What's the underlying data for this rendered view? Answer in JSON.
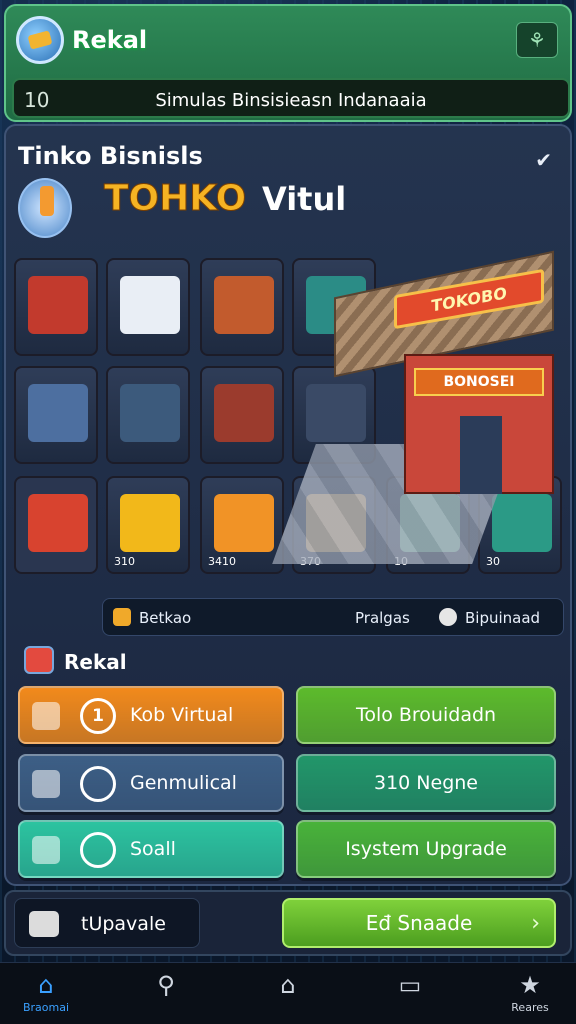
{
  "header": {
    "app_title": "Rekal",
    "level": "10",
    "subtitle": "Simulas Binsisieasn Indanaaia",
    "logo_icon": "coin-icon",
    "action_icon": "share-icon"
  },
  "panel": {
    "title": "Tinko Bisnisls",
    "collapse_icon": "chevron-down-icon",
    "brand_word1": "TOHKO",
    "brand_word2": "Vitul",
    "tiles": [
      {
        "name": "register",
        "label": "",
        "color": "#c23a2d"
      },
      {
        "name": "cart",
        "label": "",
        "color": "#e9eef5"
      },
      {
        "name": "shelf",
        "label": "",
        "color": "#c25b2d"
      },
      {
        "name": "cart-red",
        "label": "",
        "color": "#2b8c86"
      },
      {
        "name": "fridge",
        "label": "",
        "color": "#4d6fa0"
      },
      {
        "name": "blender",
        "label": "",
        "color": "#3c5a7c"
      },
      {
        "name": "display",
        "label": "",
        "color": "#9b3b2d"
      },
      {
        "name": "stall",
        "label": "",
        "color": "#3a4a66"
      },
      {
        "name": "bag",
        "label": "310",
        "color": "#f2b81a"
      },
      {
        "name": "tablet",
        "label": "3410",
        "color": "#f19326"
      },
      {
        "name": "counter",
        "label": "370",
        "color": "#e6b46b"
      },
      {
        "name": "cart-green",
        "label": "10",
        "color": "#7cc7a4"
      },
      {
        "name": "forklift",
        "label": "30",
        "color": "#2b9a86"
      }
    ],
    "store": {
      "sign_top": "TOKOBO",
      "sign_front": "BONOSEI"
    },
    "info": {
      "left_label": "Betkao",
      "mid_label": "Pralgas",
      "right_label": "Bipuinaad"
    }
  },
  "rekal": {
    "title": "Rekal",
    "buttons": [
      {
        "label": "Kob Virtual",
        "badge": "1",
        "color": "#f28a1c"
      },
      {
        "label": "Tolo Brouidadn",
        "badge": "",
        "color": "#5dbb2c"
      },
      {
        "label": "Genmulical",
        "badge": "",
        "color": "#3d5f86"
      },
      {
        "label": "310 Negne",
        "badge": "",
        "color": "#22976a"
      },
      {
        "label": "Soall",
        "badge": "",
        "color": "#2cc4a0"
      },
      {
        "label": "Isystem Upgrade",
        "badge": "",
        "color": "#49b33a"
      }
    ]
  },
  "bottom": {
    "left_label": "tUpavale",
    "right_label": "Eđ Snaade"
  },
  "nav": [
    {
      "label": "Braomai",
      "icon": "home-icon"
    },
    {
      "label": "",
      "icon": "search-icon"
    },
    {
      "label": "",
      "icon": "house-icon"
    },
    {
      "label": "",
      "icon": "window-icon"
    },
    {
      "label": "Reares",
      "icon": "star-icon"
    }
  ]
}
